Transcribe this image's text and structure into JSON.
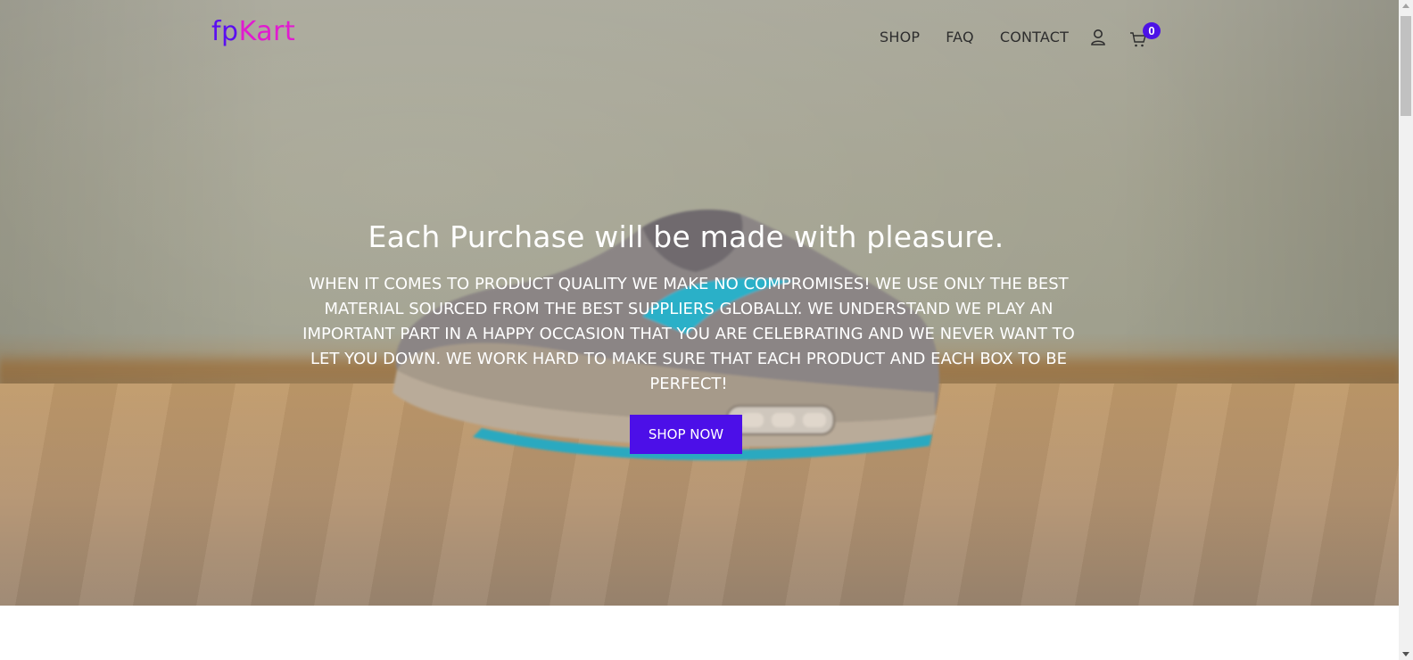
{
  "brand": {
    "part1": "fp",
    "part2": "Kart",
    "color1": "#5b0ff0",
    "color2": "#e11bd0"
  },
  "nav": {
    "items": [
      {
        "label": "SHOP"
      },
      {
        "label": "FAQ"
      },
      {
        "label": "CONTACT"
      }
    ],
    "user_icon": "user-icon",
    "cart_icon": "cart-icon",
    "cart_count": "0"
  },
  "hero": {
    "title": "Each Purchase will be made with pleasure.",
    "text": "When it comes to product quality we make no compromises! We use only the best material sourced from the best suppliers globally. We understand we play an important part in a happy occasion that you are celebrating and we never want to let you down. We work hard to make sure that each product and each box to be perfect!",
    "button_label": "SHOP NOW",
    "accent_color": "#4c0fe8"
  }
}
